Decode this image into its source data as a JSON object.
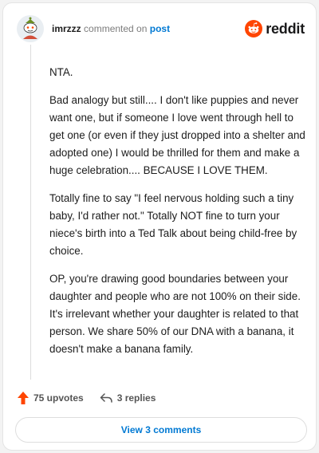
{
  "header": {
    "username": "imrzzz",
    "action_text": "commented on",
    "target_link": "post",
    "brand": "reddit"
  },
  "comment": {
    "paragraphs": [
      "NTA.",
      "Bad analogy but still.... I don't like puppies and never want one, but if someone I love went through hell to get one (or even if they just dropped into a shelter and adopted one) I would be thrilled for them and make a huge celebration.... BECAUSE I LOVE THEM.",
      "Totally fine to say \"I feel nervous holding such a tiny baby, I'd rather not.\" Totally NOT fine to turn your niece's birth into a Ted Talk about being child-free by choice.",
      "OP, you're drawing good boundaries between your daughter and people who are not 100% on their side. It's irrelevant whether your daughter is related to that person. We share 50% of our DNA with a banana, it doesn't make a banana family."
    ]
  },
  "actions": {
    "upvotes": "75 upvotes",
    "replies": "3 replies"
  },
  "view_button": "View 3 comments",
  "colors": {
    "upvote": "#ff4500",
    "link": "#0079d3",
    "brand": "#ff4500"
  }
}
